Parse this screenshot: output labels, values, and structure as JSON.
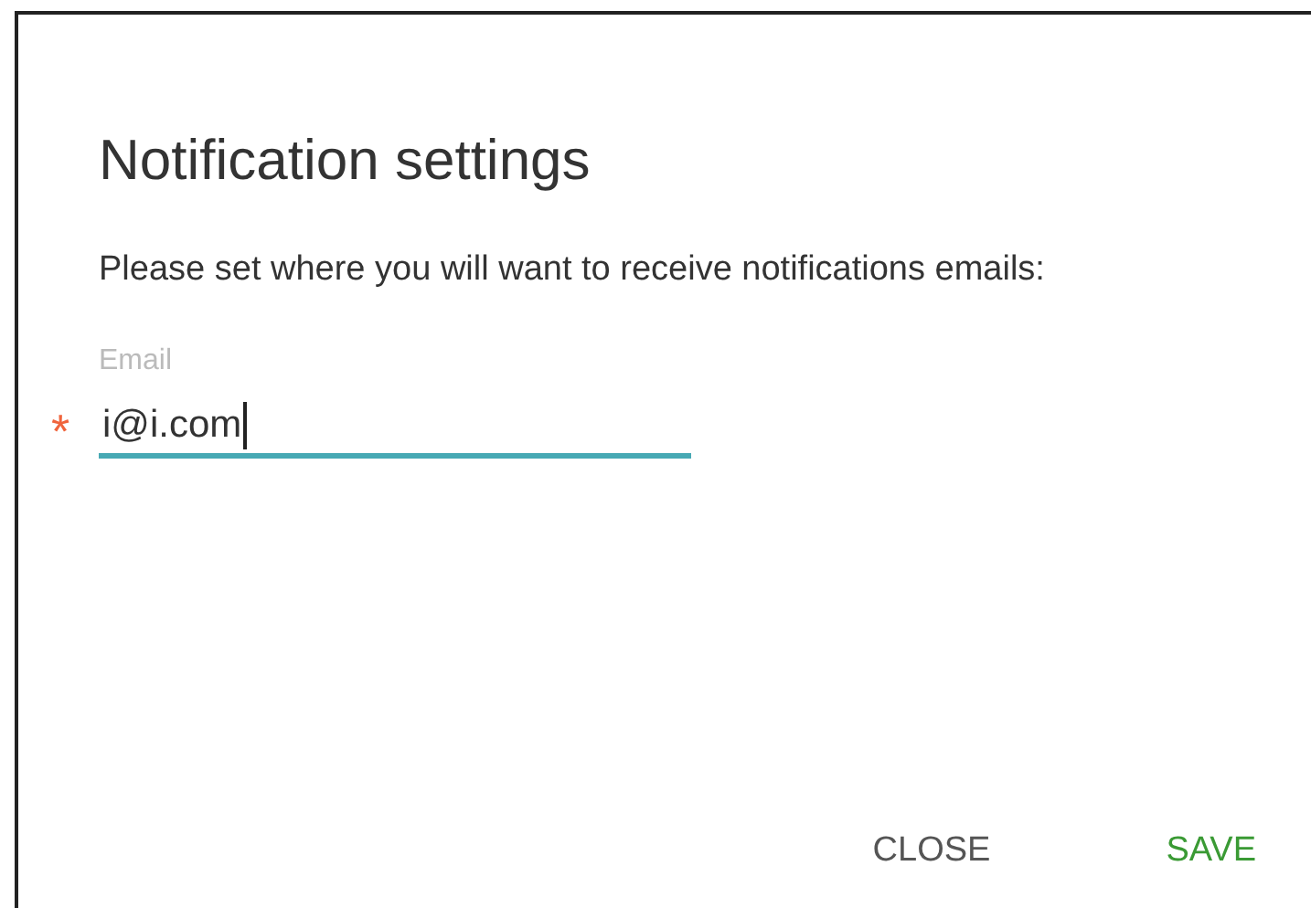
{
  "dialog": {
    "title": "Notification settings",
    "message": "Please set where you will want to receive notifications emails:",
    "email_field": {
      "label": "Email",
      "value": "i@i.com",
      "required_mark": "*",
      "focused": true
    },
    "buttons": [
      {
        "label": "CLOSE",
        "kind": "secondary"
      },
      {
        "label": "SAVE",
        "kind": "primary"
      }
    ]
  }
}
